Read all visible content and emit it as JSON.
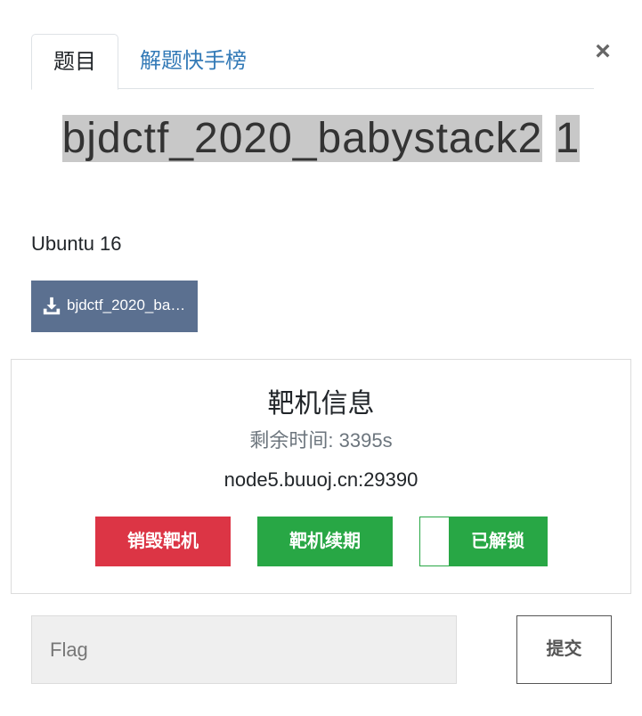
{
  "tabs": [
    {
      "label": "题目",
      "active": true
    },
    {
      "label": "解题快手榜",
      "active": false
    }
  ],
  "close_label": "×",
  "challenge": {
    "title": "bjdctf_2020_babystack2",
    "title_line2": "1",
    "description": "Ubuntu 16",
    "download_label": "bjdctf_2020_babystack2"
  },
  "target": {
    "heading": "靶机信息",
    "time_remaining": "剩余时间: 3395s",
    "address": "node5.buuoj.cn:29390",
    "destroy_label": "销毁靶机",
    "renew_label": "靶机续期",
    "unlocked_label": "已解锁"
  },
  "flag_form": {
    "placeholder": "Flag",
    "value": "",
    "submit_label": "提交"
  },
  "colors": {
    "link": "#337ab7",
    "download_bg": "#5b7090",
    "danger": "#dc3545",
    "success": "#28a745",
    "title_highlight": "#c8c8c8"
  },
  "icons": {
    "close": "close-icon",
    "download": "download-icon"
  }
}
